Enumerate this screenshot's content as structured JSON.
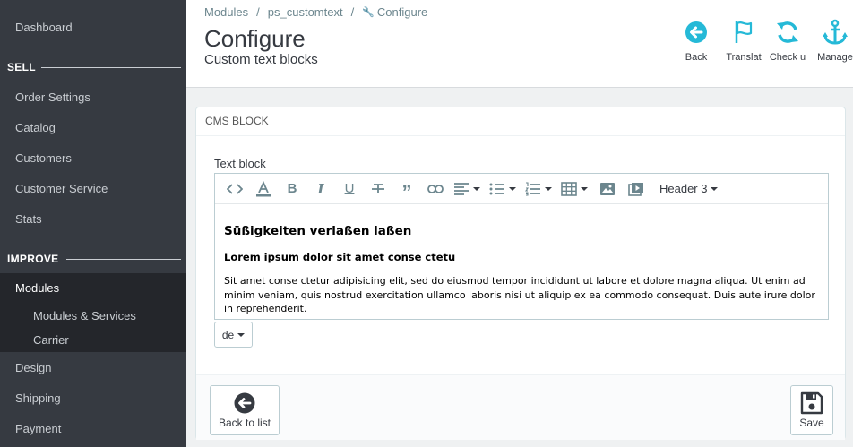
{
  "sidebar": {
    "dashboard": "Dashboard",
    "sell_heading": "SELL",
    "order_settings": "Order Settings",
    "catalog": "Catalog",
    "customers": "Customers",
    "customer_service": "Customer Service",
    "stats": "Stats",
    "improve_heading": "IMPROVE",
    "modules": "Modules",
    "modules_services": "Modules & Services",
    "carrier": "Carrier",
    "design": "Design",
    "shipping": "Shipping",
    "payment": "Payment"
  },
  "header": {
    "breadcrumb": [
      "Modules",
      "ps_customtext",
      "Configure"
    ],
    "title": "Configure",
    "subtitle": "Custom text blocks",
    "toolbar": {
      "back": "Back",
      "translate": "Translat",
      "check_update": "Check u",
      "manage_hooks": "Manage"
    }
  },
  "panel": {
    "heading": "CMS BLOCK",
    "field_label": "Text block",
    "editor": {
      "heading_dropdown": "Header 3",
      "h3": "Süßigkeiten verlaßen laßen",
      "h4": "Lorem ipsum dolor sit amet conse ctetu",
      "paragraph": "Sit amet conse ctetur adipisicing elit, sed do eiusmod tempor incididunt ut labore et dolore magna aliqua. Ut enim ad minim veniam, quis nostrud exercitation ullamco laboris nisi ut aliquip ex ea commodo consequat. Duis aute irure dolor in reprehenderit."
    },
    "language": "de",
    "back_to_list": "Back to list",
    "save": "Save"
  },
  "colors": {
    "sidebar_bg": "#363a41",
    "sidebar_active": "#24262b",
    "accent": "#25b9d7"
  }
}
